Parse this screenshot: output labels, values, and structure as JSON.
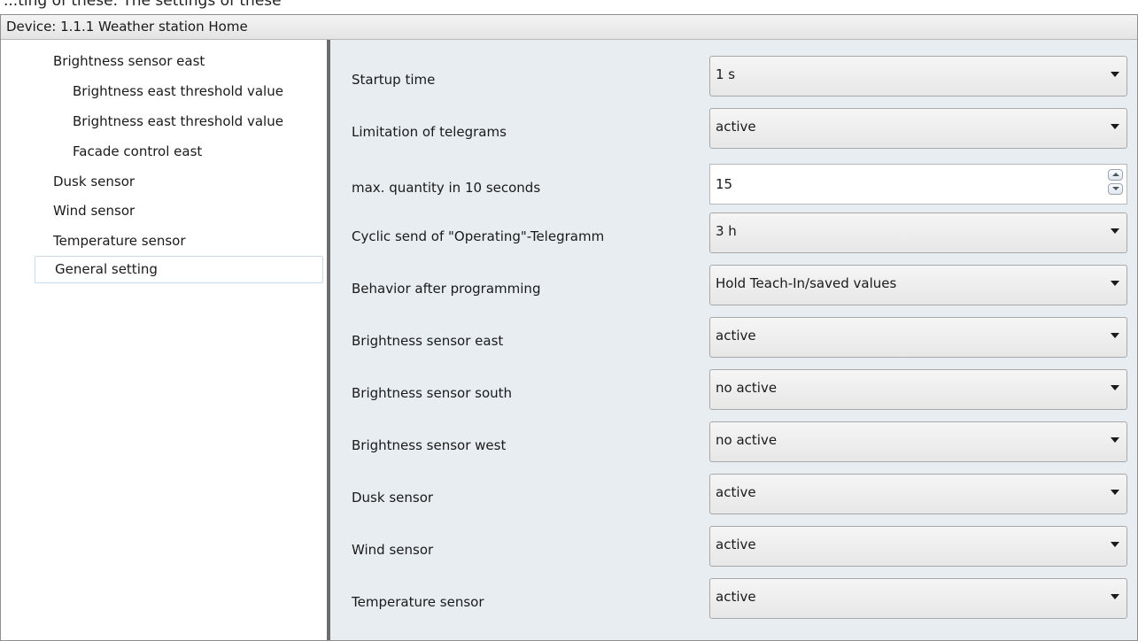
{
  "top_text": "...ting of these. The settings of these",
  "window": {
    "title": "Device: 1.1.1  Weather station Home"
  },
  "sidebar": {
    "items": [
      {
        "label": "Brightness sensor east",
        "level": 1
      },
      {
        "label": "Brightness east threshold value",
        "level": 2
      },
      {
        "label": "Brightness east threshold value",
        "level": 2
      },
      {
        "label": "Facade control east",
        "level": 2
      },
      {
        "label": "Dusk sensor",
        "level": 1
      },
      {
        "label": "Wind sensor",
        "level": 1
      },
      {
        "label": "Temperature sensor",
        "level": 1
      },
      {
        "label": "General setting",
        "level": 1,
        "selected": true
      }
    ]
  },
  "settings": {
    "rows": [
      {
        "label": "Startup time",
        "value": "1 s",
        "control": "dropdown"
      },
      {
        "label": "Limitation of telegrams",
        "value": "active",
        "control": "dropdown"
      },
      {
        "label": "max. quantity in 10 seconds",
        "value": "15",
        "control": "spinbox"
      },
      {
        "label": "Cyclic send of \"Operating\"-Telegramm",
        "value": "3 h",
        "control": "dropdown"
      },
      {
        "label": "Behavior after programming",
        "value": "Hold Teach-In/saved values",
        "control": "dropdown"
      },
      {
        "label": "Brightness sensor east",
        "value": "active",
        "control": "dropdown"
      },
      {
        "label": "Brightness sensor south",
        "value": "no active",
        "control": "dropdown"
      },
      {
        "label": "Brightness sensor west",
        "value": "no active",
        "control": "dropdown"
      },
      {
        "label": "Dusk sensor",
        "value": "active",
        "control": "dropdown"
      },
      {
        "label": "Wind sensor",
        "value": "active",
        "control": "dropdown"
      },
      {
        "label": "Temperature sensor",
        "value": "active",
        "control": "dropdown"
      }
    ]
  },
  "colors": {
    "content_background": "#e8edf2",
    "selection_border": "#c9dcef",
    "splitter": "#6d6d6d"
  }
}
